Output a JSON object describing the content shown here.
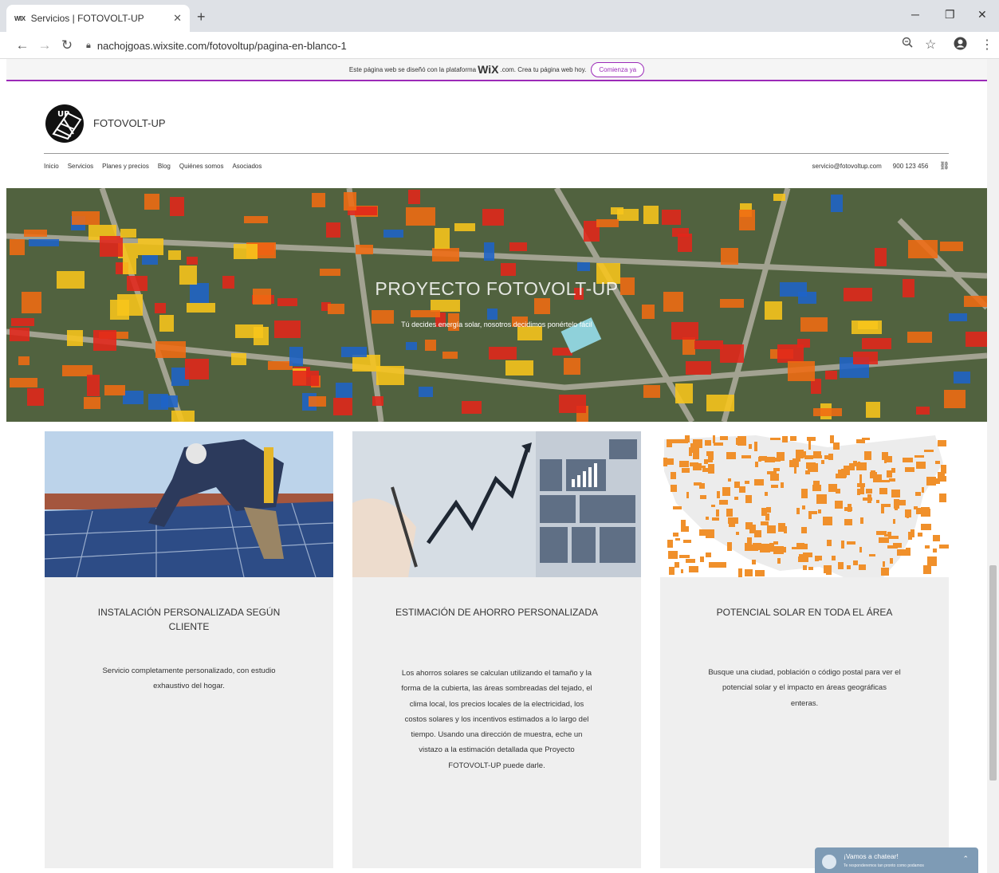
{
  "browser": {
    "tab_favicon": "WIX",
    "tab_title": "Servicios | FOTOVOLT-UP",
    "tab_close": "✕",
    "new_tab": "+",
    "url": "nachojgoas.wixsite.com/fotovoltup/pagina-en-blanco-1",
    "window_controls": {
      "minimize": "─",
      "restore": "❐",
      "close": "✕"
    }
  },
  "wix_banner": {
    "text_before": "Este página web se diseñó con la plataforma",
    "brand": "WiX",
    "text_after": ".com. Crea tu página web hoy.",
    "button": "Comienza ya"
  },
  "site": {
    "brand": "FOTOVOLT-UP",
    "menu": [
      "Inicio",
      "Servicios",
      "Planes y precios",
      "Blog",
      "Quiénes somos",
      "Asociados"
    ],
    "email": "servicio@fotovoltup.com",
    "phone": "900 123 456",
    "link_icon": "⛓"
  },
  "hero": {
    "title": "PROYECTO FOTOVOLT-UP",
    "subtitle": "Tú decides energía solar, nosotros decidimos ponértelo fácil"
  },
  "cards": [
    {
      "title": "INSTALACIÓN PERSONALIZADA SEGÚN CLIENTE",
      "text": "Servicio completamente personalizado, con estudio exhaustivo del hogar."
    },
    {
      "title": "ESTIMACIÓN DE AHORRO PERSONALIZADA",
      "text": "Los ahorros solares se calculan utilizando el tamaño y la forma de la cubierta, las áreas sombreadas del tejado, el clima local, los precios locales de la electricidad, los costos solares y los incentivos estimados a lo largo del tiempo. Usando una dirección de muestra, eche un vistazo a la estimación detallada que Proyecto FOTOVOLT-UP puede darle."
    },
    {
      "title": "POTENCIAL SOLAR EN TODA EL ÁREA",
      "text": "Busque una ciudad, población o código postal para ver el potencial solar y el impacto en áreas geográficas enteras."
    }
  ],
  "chat": {
    "title": "¡Vamos a chatear!",
    "subtitle": "Te responderemos tan pronto como podamos",
    "caret": "⌃"
  },
  "colors": {
    "wix_accent": "#9b2ab8",
    "card_bg": "#efefef",
    "map_orange": "#f0902b",
    "chat_bg": "#7e9bb5"
  },
  "icons": [
    "back-icon",
    "forward-icon",
    "reload-icon",
    "lock-icon",
    "zoom-icon",
    "star-icon",
    "profile-icon",
    "menu-icon",
    "link-icon",
    "chat-avatar-icon"
  ]
}
